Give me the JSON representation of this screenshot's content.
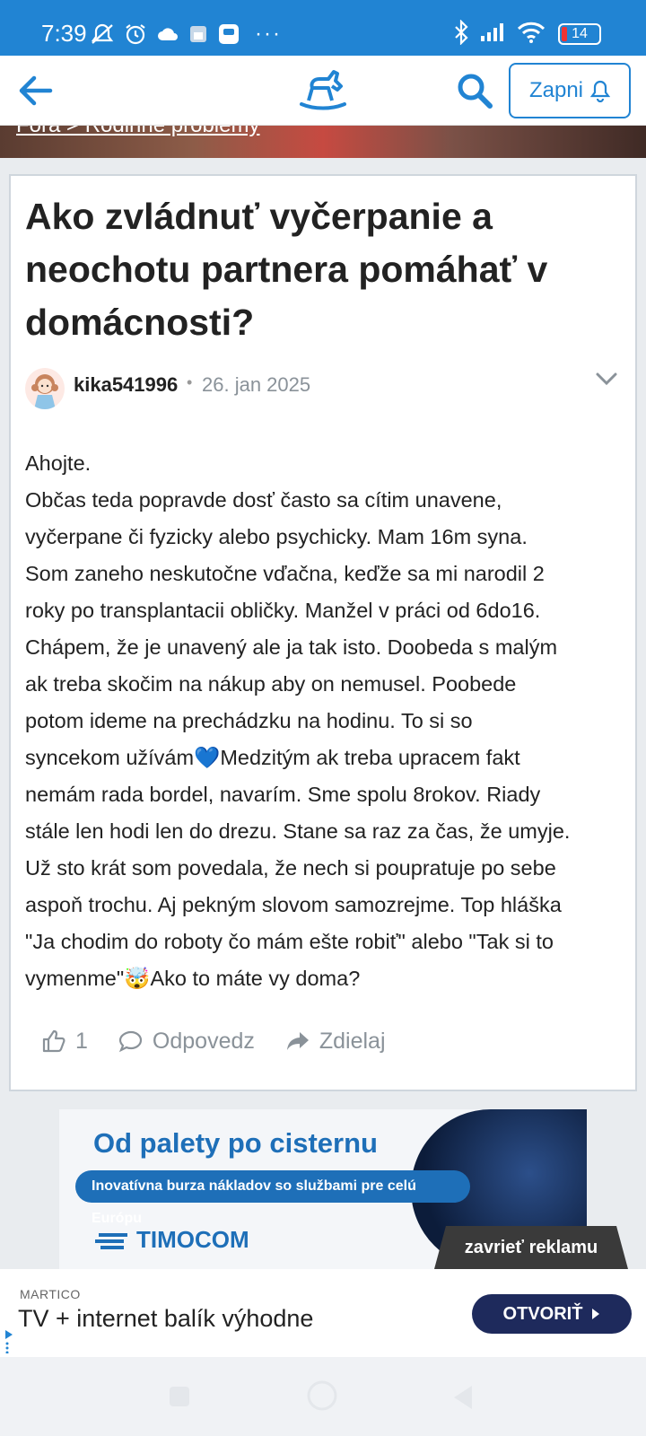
{
  "status": {
    "time": "7:39",
    "battery": "14"
  },
  "header": {
    "notify_label": "Zapni"
  },
  "breadcrumb": {
    "text": "Fóra > Rodinné problémy"
  },
  "post": {
    "title": "Ako zvládnuť vyčerpanie a neochotu partnera pomáhať v domácnosti?",
    "author": "kika541996",
    "separator": "•",
    "date": "26. jan 2025",
    "body_lines": [
      "Ahojte.",
      "Občas teda popravde dosť často sa cítim unavene,",
      "vyčerpane či fyzicky alebo psychicky. Mam 16m syna.",
      "Som zaneho neskutočne vďačna, keďže sa mi narodil 2",
      "roky po transplantacii obličky. Manžel v práci od 6do16.",
      "Chápem, že je unavený ale ja tak isto. Doobeda s malým",
      "ak treba skočim na nákup aby on nemusel. Poobede",
      "potom ideme na prechádzku na hodinu. To si so",
      "syncekom užívám💙Medzitým ak treba upracem fakt",
      "nemám rada bordel, navarím. Sme spolu 8rokov. Riady",
      "stále len hodi len do drezu. Stane sa raz za čas, že umyje.",
      "Už sto krát som povedala, že nech si poupratuje po sebe",
      "aspoň trochu. Aj pekným slovom samozrejme. Top hláška",
      "\"Ja chodim do roboty čo mám ešte robiť\" alebo \"Tak si to",
      "vymenme\"🤯Ako to máte vy doma?"
    ],
    "like_count": "1",
    "reply_label": "Odpovedz",
    "share_label": "Zdielaj"
  },
  "ad_banner": {
    "headline": "Od palety po cisternu",
    "subline": "Inovatívna burza nákladov so službami pre celú Európu",
    "brand": "TIMOCOM",
    "close_label": "zavrieť reklamu"
  },
  "ad_bottom": {
    "brand": "MARTICO",
    "text": "TV + internet balík výhodne",
    "button_label": "OTVORIŤ"
  },
  "colors": {
    "accent": "#2184d3",
    "ad_blue": "#1e6fb8",
    "ad_button": "#1e2a5c"
  }
}
